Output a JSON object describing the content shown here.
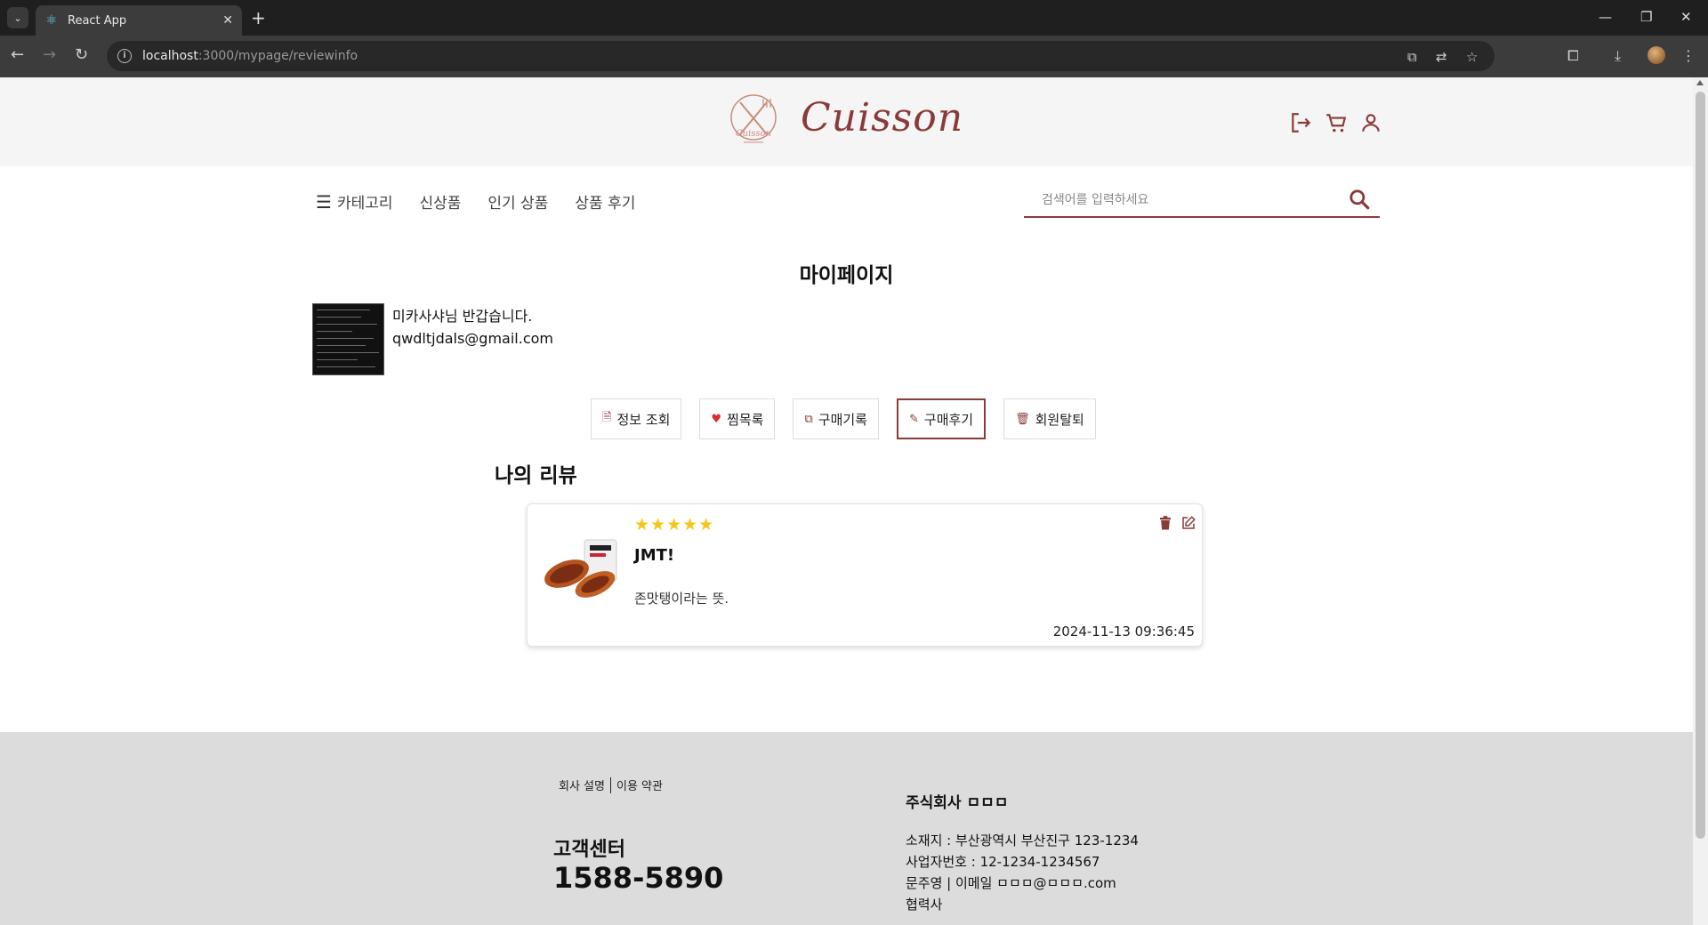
{
  "browser": {
    "tab_title": "React App",
    "url_host": "localhost",
    "url_rest": ":3000/mypage/reviewinfo",
    "favicon": "react-icon"
  },
  "header": {
    "logo_text": "Cuisson",
    "icons": [
      "logout-icon",
      "cart-icon",
      "user-icon"
    ],
    "brand_color": "#8b3a3a"
  },
  "gnb": {
    "category": "카테고리",
    "new": "신상품",
    "popular": "인기 상품",
    "reviews": "상품 후기"
  },
  "search": {
    "placeholder": "검색어를 입력하세요"
  },
  "mypage": {
    "title": "마이페이지",
    "greeting": "미카사샤님 반갑습니다.",
    "email": "qwdltjdals@gmail.com",
    "tabs": [
      {
        "label": "정보 조회",
        "icon": "document-icon"
      },
      {
        "label": "찜목록",
        "icon": "heart-icon"
      },
      {
        "label": "구매기록",
        "icon": "copy-icon"
      },
      {
        "label": "구매후기",
        "icon": "edit-icon",
        "active": true
      },
      {
        "label": "회원탈퇴",
        "icon": "trash-icon"
      }
    ]
  },
  "reviews": {
    "section_title": "나의 리뷰",
    "items": [
      {
        "rating": 5,
        "stars": "★★★★★",
        "title": "JMT!",
        "body": "존맛탱이라는 뜻.",
        "date": "2024-11-13 09:36:45"
      }
    ]
  },
  "footer": {
    "link_about": "회사 설명",
    "link_terms": "이용 약관",
    "cs_title": "고객센터",
    "cs_phone": "1588-5890",
    "company": "주식회사 ㅁㅁㅁ",
    "address": "소재지 : 부산광역시 부산진구 123-1234",
    "biz_no": "사업자번호 : 12-1234-1234567",
    "contact": "문주영 | 이메일 ㅁㅁㅁ@ㅁㅁㅁ.com",
    "partner": "협력사"
  }
}
